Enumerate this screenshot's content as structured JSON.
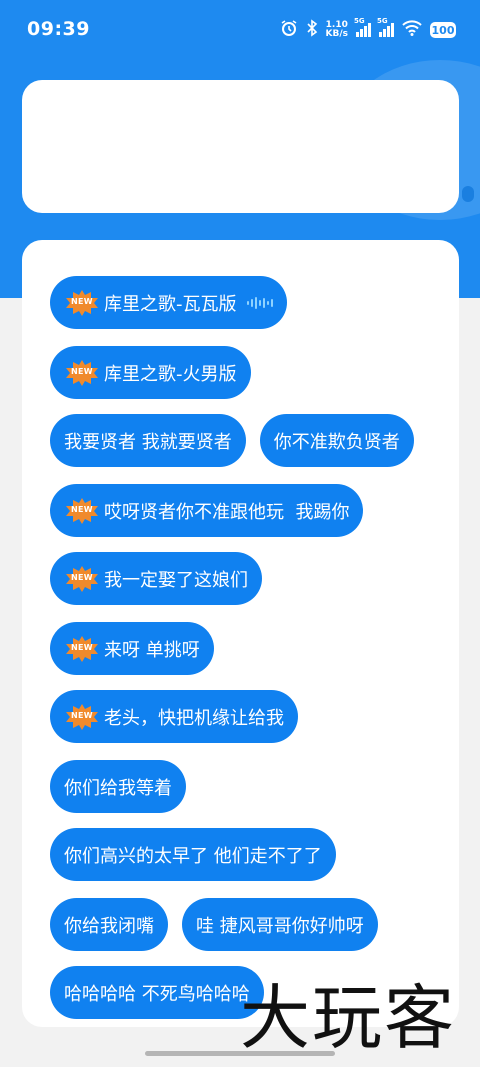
{
  "status_bar": {
    "time": "09:39",
    "net_speed_value": "1.10",
    "net_speed_unit": "KB/s",
    "signal_1_label": "5G",
    "signal_2_label": "5G",
    "battery": "100"
  },
  "watermark": "大玩客",
  "badge_text": "NEW",
  "sounds": [
    {
      "label": "库里之歌-瓦瓦版",
      "new": true,
      "playing": true
    },
    {
      "label": "库里之歌-火男版",
      "new": true,
      "playing": false
    },
    {
      "label": "我要贤者 我就要贤者",
      "new": false,
      "playing": false
    },
    {
      "label": "你不准欺负贤者",
      "new": false,
      "playing": false
    },
    {
      "label": "哎呀贤者你不准跟他玩  我踢你",
      "new": true,
      "playing": false
    },
    {
      "label": "我一定娶了这娘们",
      "new": true,
      "playing": false
    },
    {
      "label": "来呀 单挑呀",
      "new": true,
      "playing": false
    },
    {
      "label": "老头，快把机缘让给我",
      "new": true,
      "playing": false
    },
    {
      "label": "你们给我等着",
      "new": false,
      "playing": false
    },
    {
      "label": "你们高兴的太早了 他们走不了了",
      "new": false,
      "playing": false
    },
    {
      "label": "你给我闭嘴",
      "new": false,
      "playing": false
    },
    {
      "label": "哇 捷风哥哥你好帅呀",
      "new": false,
      "playing": false
    },
    {
      "label": "哈哈哈哈 不死鸟哈哈哈",
      "new": false,
      "playing": false
    }
  ],
  "colors": {
    "header_blue": "#1e8af0",
    "chip_blue": "#1081f0",
    "badge_orange": "#f08a2c"
  }
}
